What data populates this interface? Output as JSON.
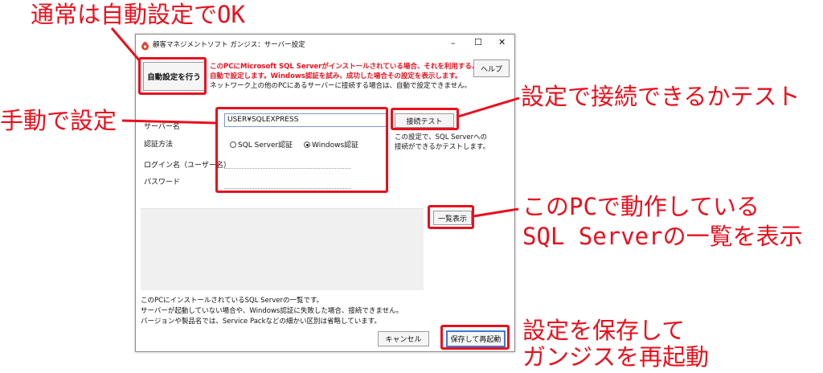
{
  "window": {
    "title": "顧客マネジメントソフト ガンジス：サーバー設定",
    "controls": [
      "–",
      "☐",
      "✕"
    ]
  },
  "auto_button": "自動設定を行う",
  "help_button": "ヘルプ",
  "info": {
    "line1": "このPCにMicrosoft SQL Serverがインストールされている場合、それを利用するように",
    "line2": "自動で設定します。Windows認証を試み、成功した場合その設定を表示します。",
    "line3": "ネットワーク上の他のPCにあるサーバーに接続する場合は、自動で設定できません。"
  },
  "form": {
    "server_label": "サーバー名",
    "server_value": "USER¥SQLEXPRESS",
    "auth_label": "認証方法",
    "auth_sql": "SQL Server認証",
    "auth_windows": "Windows認証",
    "auth_selected": "Windows認証",
    "login_label": "ログイン名（ユーザー名）",
    "password_label": "パスワード"
  },
  "test": {
    "button": "接続テスト",
    "desc1": "この設定で、SQL Serverへの",
    "desc2": "接続ができるかテストします。"
  },
  "list_button": "一覧表示",
  "footer": {
    "line1": "このPCにインストールされているSQL Serverの一覧です。",
    "line2": "サーバーが起動していない場合や、Windows認証に失敗した場合、接続できません。",
    "line3": "バージョンや製品名では、Service Packなどの細かい区別は省略しています。"
  },
  "cancel_button": "キャンセル",
  "save_button": "保存して再起動",
  "annotations": {
    "auto": "通常は自動設定でOK",
    "manual": "手動で設定",
    "test": "設定で接続できるかテスト",
    "list1": "このPCで動作している",
    "list2": "SQL Serverの一覧を表示",
    "save1": "設定を保存して",
    "save2": "ガンジスを再起動"
  },
  "colors": {
    "annotation": "#e8101d",
    "notice": "#e8101d"
  }
}
